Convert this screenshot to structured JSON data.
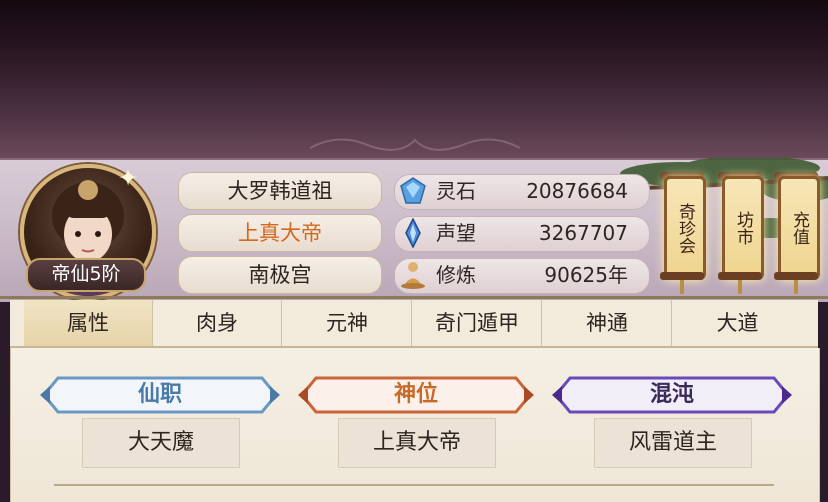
{
  "player": {
    "name": "大罗韩道祖",
    "title": "上真大帝",
    "sect": "南极宫",
    "rank": "帝仙5阶"
  },
  "stats": [
    {
      "label": "灵石",
      "value": "20876684",
      "icon": "spirit-stone-icon"
    },
    {
      "label": "声望",
      "value": "3267707",
      "icon": "prestige-crystal-icon"
    },
    {
      "label": "修炼",
      "value": "90625年",
      "icon": "meditation-icon"
    }
  ],
  "side_buttons": [
    {
      "label": "奇珍会"
    },
    {
      "label": "坊市"
    },
    {
      "label": "充值"
    }
  ],
  "tabs": [
    "属性",
    "肉身",
    "元神",
    "奇门遁甲",
    "神通",
    "大道"
  ],
  "active_tab": "属性",
  "cards": [
    {
      "head": "仙职",
      "value": "大天魔",
      "color": "#4a7aa8"
    },
    {
      "head": "神位",
      "value": "上真大帝",
      "color": "#c86a28"
    },
    {
      "head": "混沌",
      "value": "风雷道主",
      "color": "#3a2a5a"
    }
  ],
  "colors": {
    "title_orange": "#d2691e",
    "gold_border": "#c9a46a"
  }
}
